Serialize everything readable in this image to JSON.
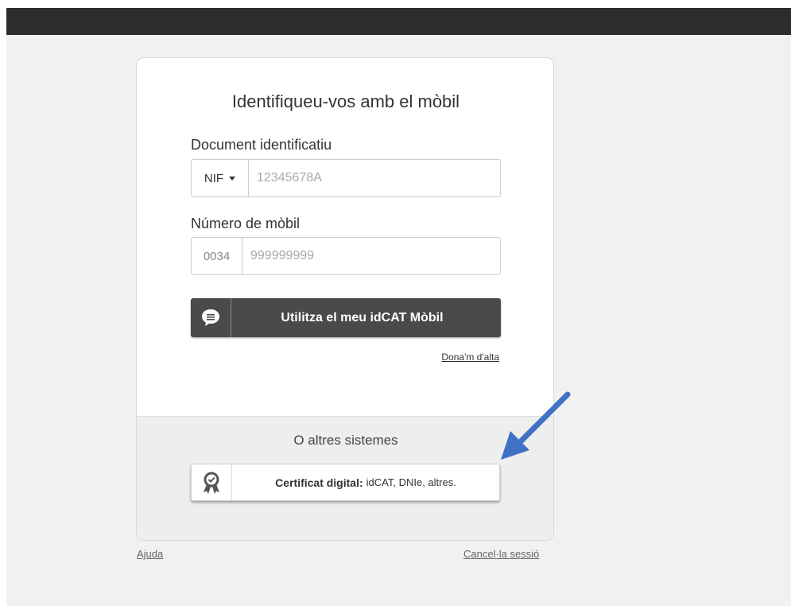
{
  "card": {
    "title": "Identifiqueu-vos amb el mòbil",
    "document": {
      "label": "Document identificatiu",
      "type_selected": "NIF",
      "placeholder": "12345678A"
    },
    "mobile": {
      "label": "Número de mòbil",
      "prefix": "0034",
      "placeholder": "999999999"
    },
    "idcat_button": {
      "label": "Utilitza el meu idCAT Mòbil",
      "icon": "speech-bubble-icon"
    },
    "signup_link": "Dona'm d'alta",
    "other_systems": {
      "title": "O altres sistemes",
      "cert_button": {
        "strong": "Certificat digital:",
        "rest": "idCAT, DNIe, altres.",
        "icon": "certificate-icon"
      }
    }
  },
  "footer": {
    "help": "Ajuda",
    "cancel": "Cancel·la sessió"
  },
  "colors": {
    "top_bar": "#2d2d2d",
    "primary_button": "#4a4a4a",
    "arrow": "#3f72c4"
  }
}
